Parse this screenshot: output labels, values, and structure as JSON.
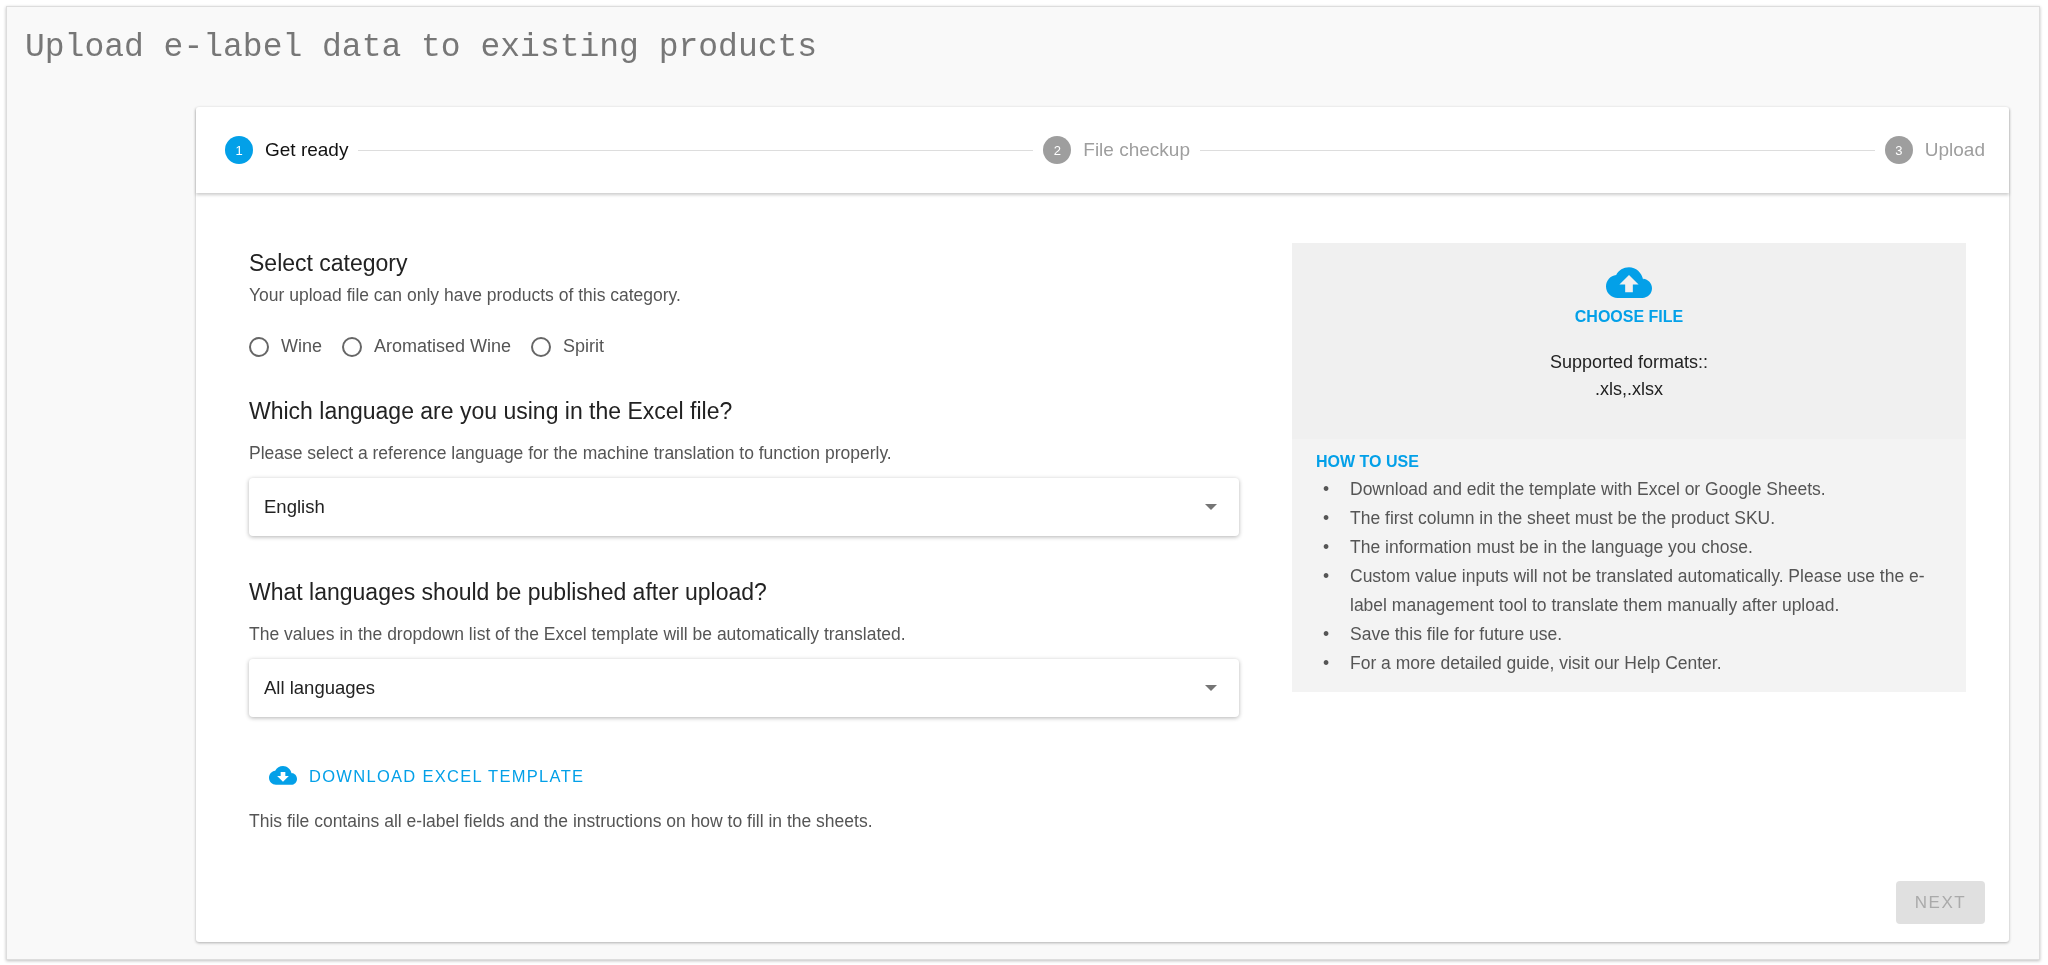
{
  "page": {
    "title": "Upload e-label data to existing products"
  },
  "steps": [
    {
      "number": "1",
      "label": "Get ready",
      "selected": true
    },
    {
      "number": "2",
      "label": "File checkup",
      "selected": false
    },
    {
      "number": "3",
      "label": "Upload",
      "selected": false
    }
  ],
  "category": {
    "heading": "Select category",
    "hint": "Your upload file can only have products of this category.",
    "options": [
      {
        "label": "Wine",
        "checked": false
      },
      {
        "label": "Aromatised Wine",
        "checked": false
      },
      {
        "label": "Spirit",
        "checked": false
      }
    ]
  },
  "reference_language": {
    "heading": "Which language are you using in the Excel file?",
    "hint": "Please select a reference language for the machine translation to function properly.",
    "value": "English"
  },
  "publish_languages": {
    "heading": "What languages should be published after upload?",
    "hint": "The values in the dropdown list of the Excel template will be automatically translated.",
    "value": "All languages"
  },
  "download": {
    "label": "DOWNLOAD EXCEL TEMPLATE",
    "note": "This file contains all e-label fields and the instructions on how to fill in the sheets."
  },
  "upload": {
    "button": "CHOOSE FILE",
    "formats_label": "Supported formats::",
    "formats": ".xls,.xlsx"
  },
  "how_to_use": {
    "heading": "HOW TO USE",
    "items": [
      {
        "bullet": "•",
        "text": "Download and edit the template with Excel or Google Sheets."
      },
      {
        "bullet": "•",
        "text": "The first column in the sheet must be the product SKU."
      },
      {
        "bullet": "•",
        "text": "The information must be in the language you chose."
      },
      {
        "bullet": "•",
        "text": "Custom value inputs will not be translated automatically. Please use the e-label management tool to translate them manually after upload."
      },
      {
        "bullet": "•",
        "text": "Save this file for future use."
      },
      {
        "bullet": "•",
        "text": "For a more detailed guide, visit our Help Center."
      }
    ]
  },
  "next_button": {
    "label": "NEXT",
    "disabled": true
  }
}
